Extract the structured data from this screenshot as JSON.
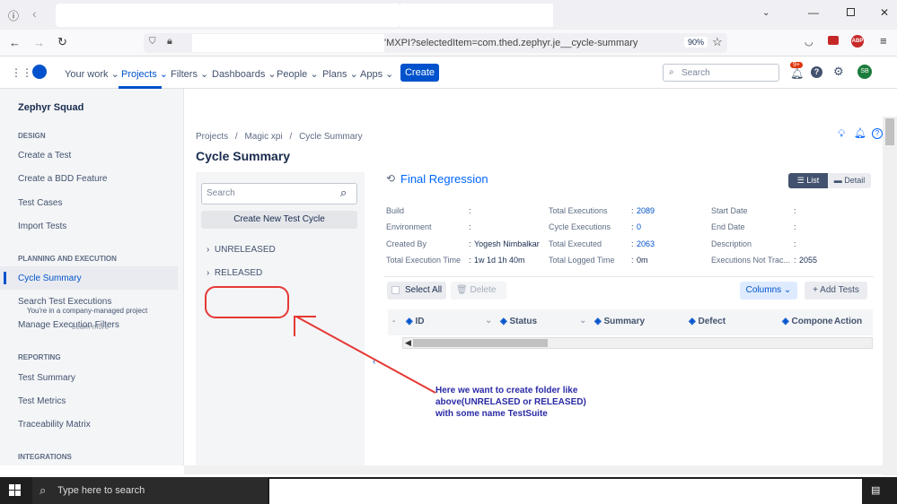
{
  "browser": {
    "url_visible": "'MXPI?selectedItem=com.thed.zephyr.je__cycle-summary",
    "zoom": "90%"
  },
  "topnav": {
    "items": [
      "Your work",
      "Projects",
      "Filters",
      "Dashboards",
      "People",
      "Plans",
      "Apps"
    ],
    "create_label": "Create",
    "search_placeholder": "Search",
    "notification_badge": "9+",
    "avatar_initials": "SB"
  },
  "sidebar": {
    "title": "Zephyr Squad",
    "design_heading": "DESIGN",
    "design_items": [
      "Create a Test",
      "Create a BDD Feature",
      "Test Cases",
      "Import Tests"
    ],
    "planning_heading": "PLANNING AND EXECUTION",
    "planning_items": [
      "Cycle Summary",
      "Search Test Executions",
      "Manage Execution Filters"
    ],
    "tooltip_line1": "You're in a company-managed project",
    "tooltip_line2": "Learn more",
    "reporting_heading": "REPORTING",
    "reporting_items": [
      "Test Summary",
      "Test Metrics",
      "Traceability Matrix"
    ],
    "integrations_heading": "INTEGRATIONS"
  },
  "breadcrumb": {
    "projects": "Projects",
    "project": "Magic xpi",
    "current": "Cycle Summary",
    "sep": "/"
  },
  "page_title": "Cycle Summary",
  "cycle_panel": {
    "search_placeholder": "Search",
    "create_label": "Create New Test Cycle",
    "folders": [
      "UNRELEASED",
      "RELEASED"
    ]
  },
  "cycle": {
    "name": "Final Regression",
    "view_list": "List",
    "view_detail": "Detail",
    "info": {
      "build_label": "Build",
      "build_value": ":",
      "environment_label": "Environment",
      "environment_value": ":",
      "created_by_label": "Created By",
      "created_by_value": "Yogesh Nimbalkar",
      "total_exec_time_label": "Total Execution Time",
      "total_exec_time_value": "1w 1d 1h 40m",
      "total_executions_label": "Total Executions",
      "total_executions_value": "2089",
      "cycle_executions_label": "Cycle Executions",
      "cycle_executions_value": "0",
      "total_executed_label": "Total Executed",
      "total_executed_value": "2063",
      "total_logged_time_label": "Total Logged Time",
      "total_logged_time_value": "0m",
      "start_date_label": "Start Date",
      "start_date_value": ":",
      "end_date_label": "End Date",
      "end_date_value": ":",
      "description_label": "Description",
      "description_value": ":",
      "not_tracked_label": "Executions Not Trac...",
      "not_tracked_value": "2055"
    },
    "toolbar": {
      "select_all": "Select All",
      "delete": "Delete",
      "columns": "Columns",
      "add_tests": "Add Tests"
    },
    "columns": [
      "ID",
      "Status",
      "Summary",
      "Defect",
      "Compone",
      "Action"
    ]
  },
  "annotation": {
    "lines": [
      "Here we want to create folder like",
      "above(UNRELASED or RELEASED)",
      "with some name TestSuite"
    ],
    "color": "#e53935"
  },
  "taskbar": {
    "search_placeholder": "Type here to search"
  }
}
